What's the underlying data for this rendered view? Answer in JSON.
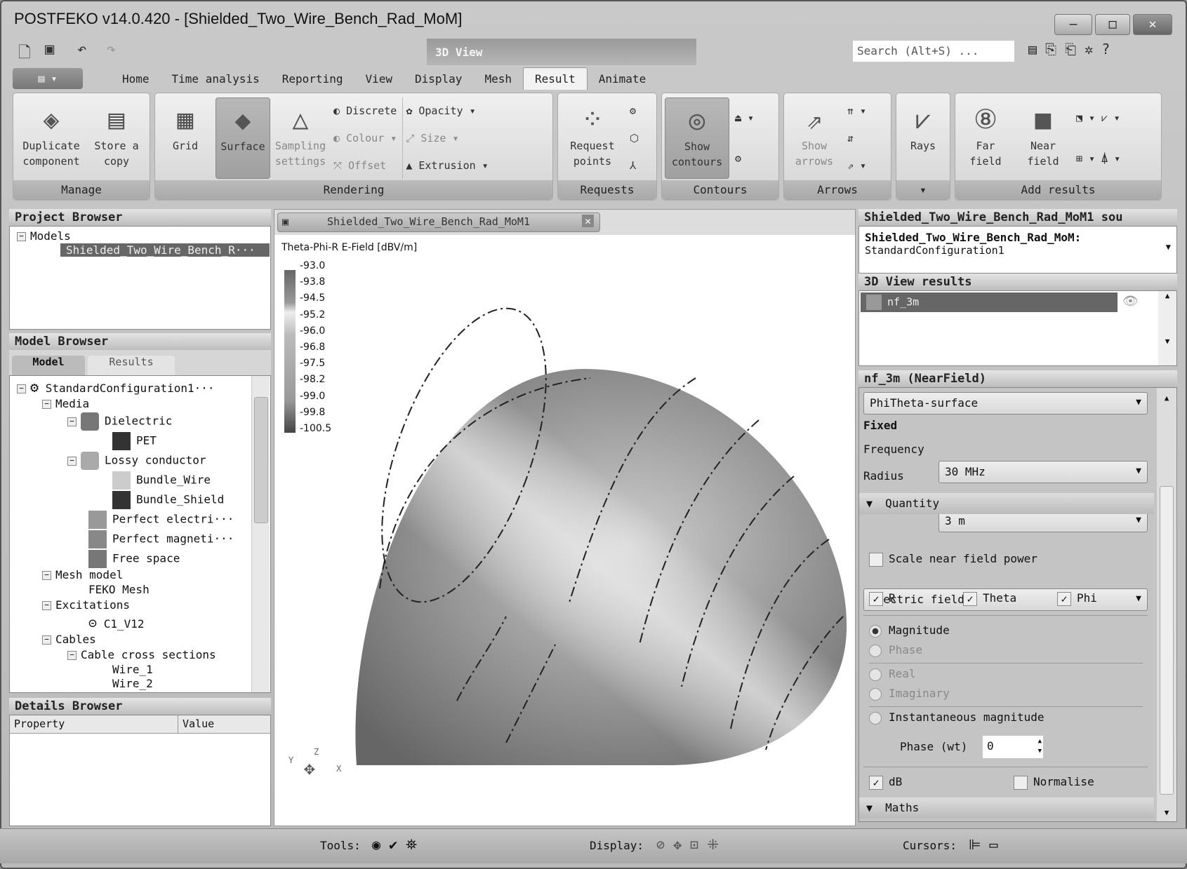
{
  "window": {
    "title": "POSTFEKO v14.0.420 - [Shielded_Two_Wire_Bench_Rad_MoM]",
    "context_tab": "3D View",
    "search_placeholder": "Search (Alt+S) ..."
  },
  "tabs": [
    {
      "label": "Home"
    },
    {
      "label": "Time analysis"
    },
    {
      "label": "Reporting"
    },
    {
      "label": "View"
    },
    {
      "label": "Display"
    },
    {
      "label": "Mesh"
    },
    {
      "label": "Result",
      "active": true
    },
    {
      "label": "Animate"
    }
  ],
  "ribbon": {
    "manage": {
      "label": "Manage",
      "duplicate": "Duplicate component",
      "store": "Store a copy"
    },
    "rendering": {
      "label": "Rendering",
      "grid": "Grid",
      "surface": "Surface",
      "sampling": "Sampling settings",
      "discrete": "Discrete",
      "colour": "Colour",
      "offset": "Offset",
      "opacity": "Opacity",
      "size": "Size",
      "extrusion": "Extrusion"
    },
    "requests": {
      "label": "Requests",
      "request_points": "Request points"
    },
    "contours": {
      "label": "Contours",
      "show_contours": "Show contours"
    },
    "arrows": {
      "label": "Arrows",
      "show_arrows": "Show arrows"
    },
    "rays": {
      "label": "Rays"
    },
    "add_results": {
      "label": "Add results",
      "far_field": "Far field",
      "near_field": "Near field"
    }
  },
  "project_browser": {
    "title": "Project Browser",
    "root": "Models",
    "item": "Shielded_Two_Wire_Bench_R···"
  },
  "model_browser": {
    "title": "Model Browser",
    "tabs": [
      "Model",
      "Results"
    ],
    "tree": {
      "config": "StandardConfiguration1···",
      "media": "Media",
      "dielectric": "Dielectric",
      "pet": "PET",
      "lossy": "Lossy conductor",
      "bundle_wire": "Bundle_Wire",
      "bundle_shield": "Bundle_Shield",
      "pec": "Perfect electri···",
      "pmc": "Perfect magneti···",
      "free_space": "Free space",
      "mesh_model": "Mesh model",
      "feko_mesh": "FEKO Mesh",
      "excitations": "Excitations",
      "c1v12": "C1_V12",
      "cables": "Cables",
      "cable_cross": "Cable cross sections",
      "wire1": "Wire_1",
      "wire2": "Wire_2"
    }
  },
  "details_browser": {
    "title": "Details Browser",
    "columns": [
      "Property",
      "Value"
    ]
  },
  "view": {
    "tab_title": "Shielded_Two_Wire_Bench_Rad_MoM1",
    "legend_title": "Theta-Phi-R E-Field [dBV/m]",
    "legend_ticks": [
      "-93.0",
      "-93.8",
      "-94.5",
      "-95.2",
      "-96.0",
      "-96.8",
      "-97.5",
      "-98.2",
      "-99.0",
      "-99.8",
      "-100.5"
    ],
    "axes": {
      "x": "X",
      "y": "Y",
      "z": "Z"
    }
  },
  "right": {
    "source_header": "Shielded_Two_Wire_Bench_Rad_MoM1 sou",
    "source_name": "Shielded_Two_Wire_Bench_Rad_MoM:",
    "source_config": "StandardConfiguration1",
    "results_header": "3D View results",
    "result_item": "nf_3m",
    "nf_header": "nf_3m (NearField)",
    "surface_type": "PhiTheta-surface",
    "fixed": "Fixed",
    "frequency_label": "Frequency",
    "frequency": "30 MHz",
    "radius_label": "Radius",
    "radius": "3 m",
    "quantity": "Quantity",
    "quantity_value": "Electric field",
    "scale_power": "Scale near field power",
    "r": "R",
    "theta": "Theta",
    "phi": "Phi",
    "magnitude": "Magnitude",
    "phase": "Phase",
    "real": "Real",
    "imaginary": "Imaginary",
    "inst_mag": "Instantaneous magnitude",
    "phase_wt_label": "Phase (wt)",
    "phase_wt": "0",
    "db": "dB",
    "normalise": "Normalise",
    "maths": "Maths"
  },
  "status": {
    "tools": "Tools:",
    "display": "Display:",
    "cursors": "Cursors:"
  }
}
